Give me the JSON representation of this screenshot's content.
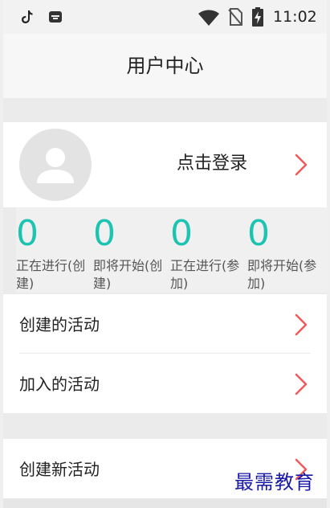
{
  "status_bar": {
    "time": "11:02",
    "icons": [
      "tiktok-icon",
      "app-icon",
      "wifi-icon",
      "no-sim-icon",
      "battery-charging-icon"
    ]
  },
  "header": {
    "title": "用户中心"
  },
  "profile": {
    "login_label": "点击登录",
    "avatar_icon": "user-avatar-icon"
  },
  "stats": [
    {
      "value": "0",
      "label": "正在进行(创建)"
    },
    {
      "value": "0",
      "label": "即将开始(创建)"
    },
    {
      "value": "0",
      "label": "正在进行(参加)"
    },
    {
      "value": "0",
      "label": "即将开始(参加)"
    }
  ],
  "menu": {
    "created_activities": "创建的活动",
    "joined_activities": "加入的活动",
    "create_new_activity": "创建新活动"
  },
  "watermark": "最需教育",
  "colors": {
    "accent": "#1ec4b2",
    "chevron": "#f05a5a",
    "watermark": "#1a1aa8"
  }
}
